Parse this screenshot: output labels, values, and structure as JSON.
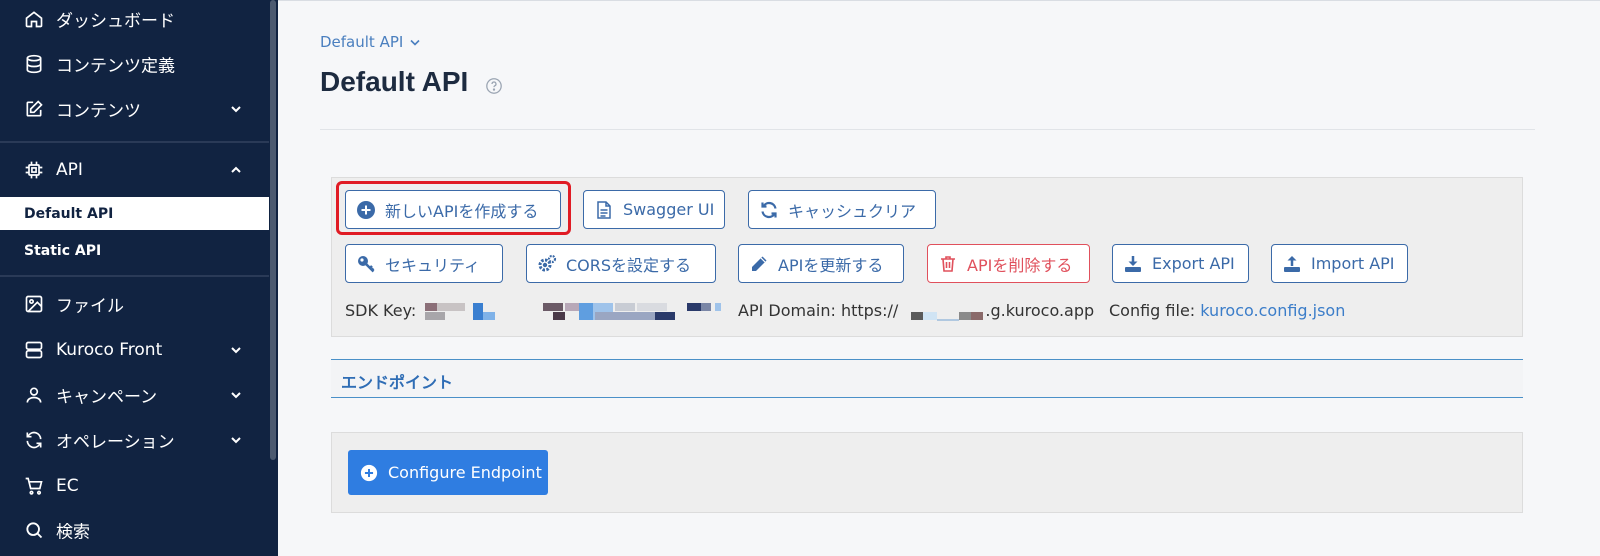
{
  "sidebar": {
    "items": [
      {
        "label": "ダッシュボード",
        "icon": "home-icon"
      },
      {
        "label": "コンテンツ定義",
        "icon": "database-icon"
      },
      {
        "label": "コンテンツ",
        "icon": "edit-icon"
      },
      {
        "label": "API",
        "icon": "chip-icon"
      },
      {
        "label": "ファイル",
        "icon": "image-icon"
      },
      {
        "label": "Kuroco Front",
        "icon": "server-icon"
      },
      {
        "label": "キャンペーン",
        "icon": "user-icon"
      },
      {
        "label": "オペレーション",
        "icon": "refresh-icon"
      },
      {
        "label": "EC",
        "icon": "cart-icon"
      },
      {
        "label": "検索",
        "icon": "search-icon"
      }
    ],
    "api_sub": [
      {
        "label": "Default API",
        "active": true
      },
      {
        "label": "Static API",
        "active": false
      }
    ]
  },
  "header": {
    "breadcrumb": "Default API",
    "title": "Default API"
  },
  "toolbar": {
    "create_api": "新しいAPIを作成する",
    "swagger": "Swagger UI",
    "cache_clear": "キャッシュクリア",
    "security": "セキュリティ",
    "cors": "CORSを設定する",
    "update_api": "APIを更新する",
    "delete_api": "APIを削除する",
    "export_api": "Export API",
    "import_api": "Import API"
  },
  "info": {
    "sdk_key_label": "SDK Key:",
    "api_domain_label": "API Domain: https://",
    "api_domain_suffix": ".g.kuroco.app",
    "config_file_label": "Config file:",
    "config_file_link": "kuroco.config.json"
  },
  "endpoints": {
    "section_title": "エンドポイント",
    "configure_button": "Configure Endpoint"
  },
  "colors": {
    "sidebar_bg": "#112341",
    "accent": "#3b6aa8",
    "primary": "#2f7de1",
    "danger": "#e0505c",
    "highlight": "#e01b24"
  }
}
